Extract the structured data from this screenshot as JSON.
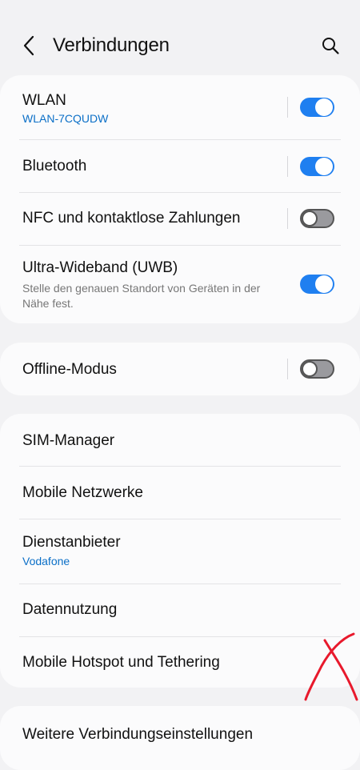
{
  "header": {
    "title": "Verbindungen",
    "back_icon": "back-arrow-icon",
    "search_icon": "search-icon"
  },
  "group1": [
    {
      "label": "WLAN",
      "sub": "WLAN-7CQUDW",
      "toggle": true
    },
    {
      "label": "Bluetooth",
      "toggle": true
    },
    {
      "label": "NFC und kontaktlose Zahlungen",
      "toggle": false
    },
    {
      "label": "Ultra-Wideband (UWB)",
      "desc": "Stelle den genauen Standort von Geräten in der Nähe fest.",
      "toggle": true
    }
  ],
  "group2": [
    {
      "label": "Offline-Modus",
      "toggle": false
    }
  ],
  "group3": [
    {
      "label": "SIM-Manager"
    },
    {
      "label": "Mobile Netzwerke"
    },
    {
      "label": "Dienstanbieter",
      "sub": "Vodafone"
    },
    {
      "label": "Datennutzung"
    },
    {
      "label": "Mobile Hotspot und Tethering"
    }
  ],
  "group4": [
    {
      "label": "Weitere Verbindungseinstellungen"
    }
  ],
  "colors": {
    "accent": "#1f7ff0",
    "sub_text": "#0b6fc7",
    "annotation": "#e8192c"
  }
}
